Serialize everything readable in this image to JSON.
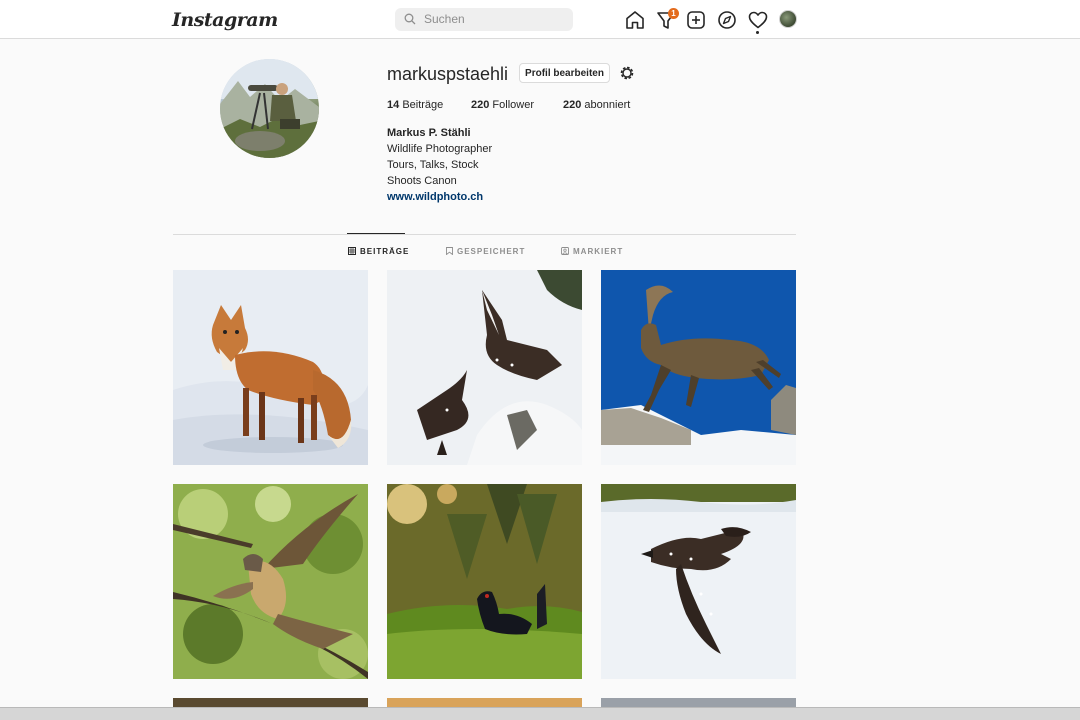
{
  "header": {
    "logo": "Instagram",
    "search_placeholder": "Suchen",
    "activity_badge": "1",
    "icons": [
      "home-icon",
      "activity-filter-icon",
      "new-post-icon",
      "explore-icon",
      "heart-icon",
      "profile-avatar"
    ]
  },
  "profile": {
    "username": "markuspstaehli",
    "edit_button": "Profil bearbeiten",
    "stats": {
      "posts_count": "14",
      "posts_label": "Beiträge",
      "followers_count": "220",
      "followers_label": "Follower",
      "following_count": "220",
      "following_label": "abonniert"
    },
    "full_name": "Markus P. Stähli",
    "bio_lines": [
      "Wildlife Photographer",
      "Tours, Talks, Stock",
      "Shoots Canon"
    ],
    "website": "www.wildphoto.ch"
  },
  "tabs": [
    {
      "label": "BEITRÄGE",
      "icon": "grid-icon",
      "active": true
    },
    {
      "label": "GESPEICHERT",
      "icon": "bookmark-icon",
      "active": false
    },
    {
      "label": "MARKIERT",
      "icon": "tagged-icon",
      "active": false
    }
  ],
  "posts": [
    {
      "subject": "fox-in-snow"
    },
    {
      "subject": "nutcrackers-in-snow"
    },
    {
      "subject": "ibex-jumping"
    },
    {
      "subject": "kestrel-in-tree"
    },
    {
      "subject": "black-grouse-in-forest"
    },
    {
      "subject": "nutcracker-flying"
    }
  ],
  "colors": {
    "background": "#fafafa",
    "border": "#dbdbdb",
    "text": "#262626",
    "secondary_text": "#8e8e8e",
    "link": "#00376b",
    "badge": "#e36b1c"
  }
}
